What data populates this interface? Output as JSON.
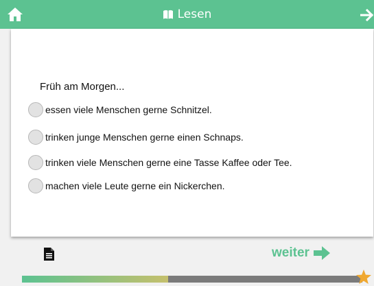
{
  "header": {
    "title": "Lesen",
    "home_icon": "home-icon",
    "book_icon": "book-icon",
    "next_icon": "arrow-right-icon",
    "background": "#5cc291"
  },
  "quiz": {
    "question": "Früh am Morgen...",
    "options": [
      "essen viele Menschen gerne Schnitzel.",
      "trinken junge Menschen gerne einen Schnaps.",
      "trinken viele Menschen gerne eine Tasse Kaffee oder Tee.",
      "machen viele Leute gerne ein Nickerchen."
    ],
    "selected": null
  },
  "footer": {
    "doc_icon": "document-icon",
    "weiter_label": "weiter",
    "weiter_icon": "arrow-right-icon",
    "accent": "#5cc291"
  },
  "progress": {
    "fraction": 0.43,
    "star_icon": "star-icon",
    "star_color": "#f0a830"
  }
}
